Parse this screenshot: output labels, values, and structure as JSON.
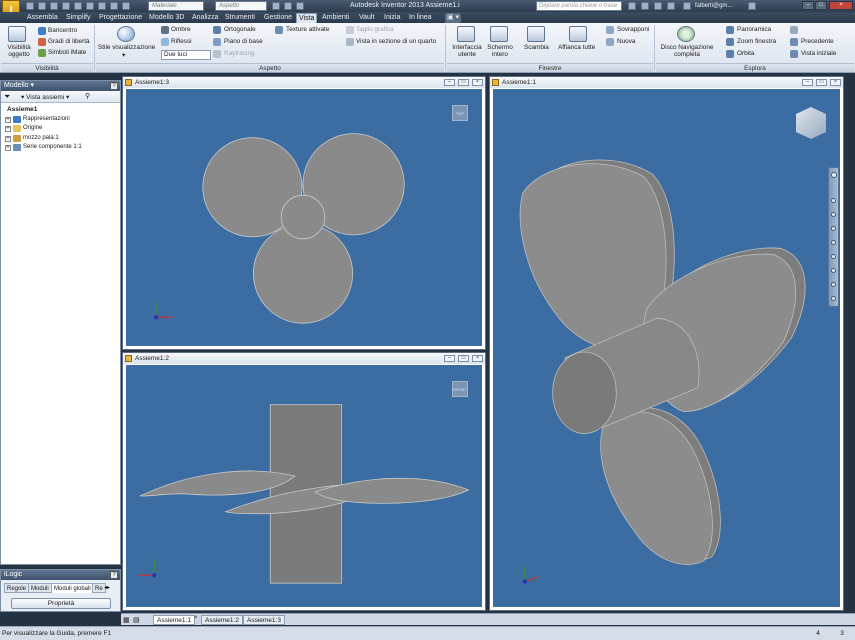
{
  "titlebar": {
    "style_combo": "Materiale",
    "appearance_combo": "Aspetto",
    "title": "Autodesk Inventor 2013    Assieme1.i",
    "search_placeholder": "Digitare parola chiave o frase",
    "user": "falberti@gm..."
  },
  "tabs": [
    "Assembla",
    "Simplify",
    "Progettazione",
    "Modello 3D",
    "Analizza",
    "Strumenti",
    "Gestione",
    "Vista",
    "Ambienti",
    "Vault",
    "Inizia",
    "In linea"
  ],
  "ribbon": {
    "visibility": {
      "object_visibility": "Visibilità oggetto",
      "center_of_gravity": "Baricentro",
      "degrees_of_freedom": "Gradi di libertà",
      "imate_symbols": "Simboli iMate",
      "group": "Visibilità"
    },
    "appearance": {
      "visual_style": "Stile visualizzazione",
      "shadows": "Ombre",
      "reflections": "Riflessi",
      "lights": "Due luci",
      "orthographic": "Ortogonale",
      "ground_plane": "Piano di base",
      "raytracing": "Raytracing",
      "textures": "Texture attivate",
      "section_cut": "Taglio grafica",
      "quarter_section": "Vista in sezione di un quarto",
      "group": "Aspetto"
    },
    "windows": {
      "user_interface": "Interfaccia utente",
      "full_screen": "Schermo intero",
      "switch": "Scambia",
      "tile_all": "Affianca tutte",
      "cascade": "Sovrapponi",
      "new": "Nuova",
      "group": "Finestre"
    },
    "navigate": {
      "steering_wheel": "Disco Navigazione completa",
      "pan": "Panoramica",
      "zoom_window": "Zoom finestra",
      "orbit": "Orbita",
      "previous": "Precedente",
      "home_view": "Vista iniziale",
      "group": "Esplora"
    }
  },
  "model_panel": {
    "title": "Modello",
    "view_selector": "Vista assiemi",
    "tree": [
      {
        "label": "Assieme1",
        "root": true
      },
      {
        "label": "Rappresentazioni",
        "icon_color": "#3d7cc9"
      },
      {
        "label": "Origine",
        "icon_color": "#e7c45a"
      },
      {
        "label": "mozzo pala:1",
        "icon_color": "#c9a23d"
      },
      {
        "label": "Serie componente 1:1",
        "icon_color": "#6a8cb8"
      }
    ]
  },
  "ilogic": {
    "title": "iLogic",
    "tabs": [
      "Regole",
      "Moduli",
      "Moduli globali",
      "Re"
    ],
    "properties_button": "Proprietà"
  },
  "viewports": [
    {
      "title": "Assieme1:3"
    },
    {
      "title": "Assieme1:2"
    },
    {
      "title": "Assieme1:1"
    }
  ],
  "doc_tabs": [
    "Assieme1:1",
    "Assieme1:2",
    "Assieme1:3"
  ],
  "status": {
    "text": "Per visualizzare la Guida, premere F1",
    "num1": "4",
    "num2": "3"
  },
  "colors": {
    "viewport_bg": "#3c6da2",
    "part_gray": "#8a8a8a",
    "accent_orange": "#e7b63a"
  }
}
